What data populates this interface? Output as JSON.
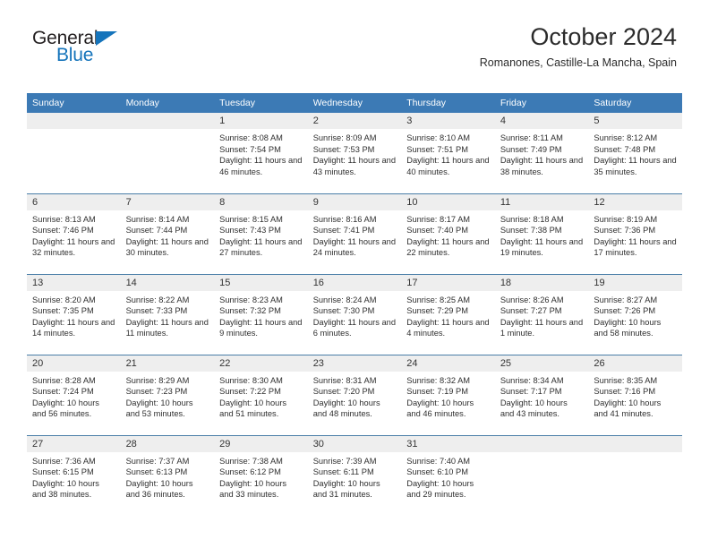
{
  "brand": {
    "name_part1": "General",
    "name_part2": "Blue",
    "triangle_icon": "triangle-icon",
    "accent_color": "#1574bb"
  },
  "header": {
    "title": "October 2024",
    "subtitle": "Romanones, Castille-La Mancha, Spain"
  },
  "calendar": {
    "header_bg": "#3c7ab5",
    "daynum_bg": "#eeeeee",
    "weekdays": [
      "Sunday",
      "Monday",
      "Tuesday",
      "Wednesday",
      "Thursday",
      "Friday",
      "Saturday"
    ],
    "weeks": [
      [
        {
          "day": "",
          "empty": true
        },
        {
          "day": "",
          "empty": true
        },
        {
          "day": "1",
          "sunrise": "Sunrise: 8:08 AM",
          "sunset": "Sunset: 7:54 PM",
          "daylight": "Daylight: 11 hours and 46 minutes."
        },
        {
          "day": "2",
          "sunrise": "Sunrise: 8:09 AM",
          "sunset": "Sunset: 7:53 PM",
          "daylight": "Daylight: 11 hours and 43 minutes."
        },
        {
          "day": "3",
          "sunrise": "Sunrise: 8:10 AM",
          "sunset": "Sunset: 7:51 PM",
          "daylight": "Daylight: 11 hours and 40 minutes."
        },
        {
          "day": "4",
          "sunrise": "Sunrise: 8:11 AM",
          "sunset": "Sunset: 7:49 PM",
          "daylight": "Daylight: 11 hours and 38 minutes."
        },
        {
          "day": "5",
          "sunrise": "Sunrise: 8:12 AM",
          "sunset": "Sunset: 7:48 PM",
          "daylight": "Daylight: 11 hours and 35 minutes."
        }
      ],
      [
        {
          "day": "6",
          "sunrise": "Sunrise: 8:13 AM",
          "sunset": "Sunset: 7:46 PM",
          "daylight": "Daylight: 11 hours and 32 minutes."
        },
        {
          "day": "7",
          "sunrise": "Sunrise: 8:14 AM",
          "sunset": "Sunset: 7:44 PM",
          "daylight": "Daylight: 11 hours and 30 minutes."
        },
        {
          "day": "8",
          "sunrise": "Sunrise: 8:15 AM",
          "sunset": "Sunset: 7:43 PM",
          "daylight": "Daylight: 11 hours and 27 minutes."
        },
        {
          "day": "9",
          "sunrise": "Sunrise: 8:16 AM",
          "sunset": "Sunset: 7:41 PM",
          "daylight": "Daylight: 11 hours and 24 minutes."
        },
        {
          "day": "10",
          "sunrise": "Sunrise: 8:17 AM",
          "sunset": "Sunset: 7:40 PM",
          "daylight": "Daylight: 11 hours and 22 minutes."
        },
        {
          "day": "11",
          "sunrise": "Sunrise: 8:18 AM",
          "sunset": "Sunset: 7:38 PM",
          "daylight": "Daylight: 11 hours and 19 minutes."
        },
        {
          "day": "12",
          "sunrise": "Sunrise: 8:19 AM",
          "sunset": "Sunset: 7:36 PM",
          "daylight": "Daylight: 11 hours and 17 minutes."
        }
      ],
      [
        {
          "day": "13",
          "sunrise": "Sunrise: 8:20 AM",
          "sunset": "Sunset: 7:35 PM",
          "daylight": "Daylight: 11 hours and 14 minutes."
        },
        {
          "day": "14",
          "sunrise": "Sunrise: 8:22 AM",
          "sunset": "Sunset: 7:33 PM",
          "daylight": "Daylight: 11 hours and 11 minutes."
        },
        {
          "day": "15",
          "sunrise": "Sunrise: 8:23 AM",
          "sunset": "Sunset: 7:32 PM",
          "daylight": "Daylight: 11 hours and 9 minutes."
        },
        {
          "day": "16",
          "sunrise": "Sunrise: 8:24 AM",
          "sunset": "Sunset: 7:30 PM",
          "daylight": "Daylight: 11 hours and 6 minutes."
        },
        {
          "day": "17",
          "sunrise": "Sunrise: 8:25 AM",
          "sunset": "Sunset: 7:29 PM",
          "daylight": "Daylight: 11 hours and 4 minutes."
        },
        {
          "day": "18",
          "sunrise": "Sunrise: 8:26 AM",
          "sunset": "Sunset: 7:27 PM",
          "daylight": "Daylight: 11 hours and 1 minute."
        },
        {
          "day": "19",
          "sunrise": "Sunrise: 8:27 AM",
          "sunset": "Sunset: 7:26 PM",
          "daylight": "Daylight: 10 hours and 58 minutes."
        }
      ],
      [
        {
          "day": "20",
          "sunrise": "Sunrise: 8:28 AM",
          "sunset": "Sunset: 7:24 PM",
          "daylight": "Daylight: 10 hours and 56 minutes."
        },
        {
          "day": "21",
          "sunrise": "Sunrise: 8:29 AM",
          "sunset": "Sunset: 7:23 PM",
          "daylight": "Daylight: 10 hours and 53 minutes."
        },
        {
          "day": "22",
          "sunrise": "Sunrise: 8:30 AM",
          "sunset": "Sunset: 7:22 PM",
          "daylight": "Daylight: 10 hours and 51 minutes."
        },
        {
          "day": "23",
          "sunrise": "Sunrise: 8:31 AM",
          "sunset": "Sunset: 7:20 PM",
          "daylight": "Daylight: 10 hours and 48 minutes."
        },
        {
          "day": "24",
          "sunrise": "Sunrise: 8:32 AM",
          "sunset": "Sunset: 7:19 PM",
          "daylight": "Daylight: 10 hours and 46 minutes."
        },
        {
          "day": "25",
          "sunrise": "Sunrise: 8:34 AM",
          "sunset": "Sunset: 7:17 PM",
          "daylight": "Daylight: 10 hours and 43 minutes."
        },
        {
          "day": "26",
          "sunrise": "Sunrise: 8:35 AM",
          "sunset": "Sunset: 7:16 PM",
          "daylight": "Daylight: 10 hours and 41 minutes."
        }
      ],
      [
        {
          "day": "27",
          "sunrise": "Sunrise: 7:36 AM",
          "sunset": "Sunset: 6:15 PM",
          "daylight": "Daylight: 10 hours and 38 minutes."
        },
        {
          "day": "28",
          "sunrise": "Sunrise: 7:37 AM",
          "sunset": "Sunset: 6:13 PM",
          "daylight": "Daylight: 10 hours and 36 minutes."
        },
        {
          "day": "29",
          "sunrise": "Sunrise: 7:38 AM",
          "sunset": "Sunset: 6:12 PM",
          "daylight": "Daylight: 10 hours and 33 minutes."
        },
        {
          "day": "30",
          "sunrise": "Sunrise: 7:39 AM",
          "sunset": "Sunset: 6:11 PM",
          "daylight": "Daylight: 10 hours and 31 minutes."
        },
        {
          "day": "31",
          "sunrise": "Sunrise: 7:40 AM",
          "sunset": "Sunset: 6:10 PM",
          "daylight": "Daylight: 10 hours and 29 minutes."
        },
        {
          "day": "",
          "empty": true
        },
        {
          "day": "",
          "empty": true
        }
      ]
    ]
  }
}
